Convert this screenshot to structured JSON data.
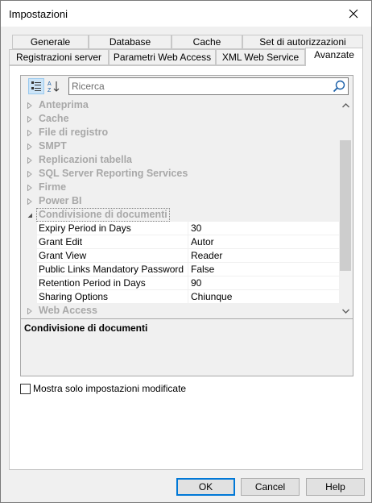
{
  "window": {
    "title": "Impostazioni"
  },
  "tabs": {
    "row1": [
      "Generale",
      "Database",
      "Cache",
      "Set di autorizzazioni"
    ],
    "row2": [
      "Registrazioni server",
      "Parametri Web Access",
      "XML Web Service",
      "Avanzate"
    ],
    "active": "Avanzate"
  },
  "search": {
    "placeholder": "Ricerca",
    "value": ""
  },
  "grid": {
    "categories_before": [
      "Anteprima",
      "Cache",
      "File di registro",
      "SMPT",
      "Replicazioni tabella",
      "SQL Server Reporting Services",
      "Firme",
      "Power BI"
    ],
    "expanded_category": "Condivisione di documenti",
    "properties": [
      {
        "name": "Expiry Period in Days",
        "value": "30"
      },
      {
        "name": "Grant Edit",
        "value": "Autor"
      },
      {
        "name": "Grant View",
        "value": "Reader"
      },
      {
        "name": "Public Links Mandatory Password",
        "value": "False"
      },
      {
        "name": "Retention Period in Days",
        "value": "90"
      },
      {
        "name": "Sharing Options",
        "value": "Chiunque"
      }
    ],
    "categories_after": [
      "Web Access"
    ]
  },
  "description": {
    "title": "Condivisione di documenti"
  },
  "options": {
    "show_modified_only_label": "Mostra solo impostazioni modificate",
    "show_modified_only_checked": false
  },
  "buttons": {
    "ok": "OK",
    "cancel": "Cancel",
    "help": "Help"
  },
  "icons": {
    "close": "close-icon",
    "categorized": "categorized-view-icon",
    "alphabetical": "alphabetical-sort-icon",
    "search": "search-icon",
    "collapsed": "triangle-right-icon",
    "expanded": "triangle-down-icon",
    "scroll_up": "chevron-up-icon",
    "scroll_down": "chevron-down-icon"
  },
  "colors": {
    "accent": "#0078d7",
    "disabled_text": "#a8a8a8",
    "search_icon": "#1a5fa8",
    "pressed_button": "#cce4f7"
  }
}
